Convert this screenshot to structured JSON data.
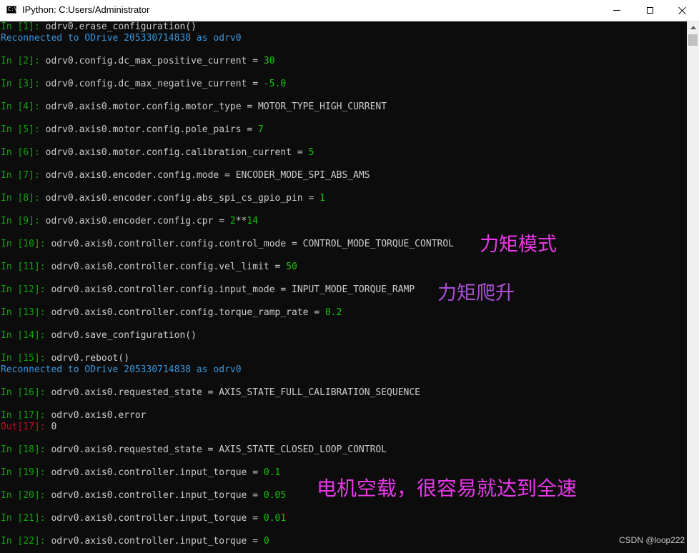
{
  "window": {
    "title": "IPython: C:Users/Administrator",
    "icon_label": "C:\\",
    "buttons": {
      "minimize": "minimize-icon",
      "maximize": "maximize-icon",
      "close": "close-icon"
    }
  },
  "colors": {
    "background": "#0c0c0c",
    "prompt_in": "#13a10e",
    "prompt_out": "#c50f1f",
    "message": "#3a96dd",
    "number": "#16c60c",
    "annotation_magenta": "#e838e8",
    "annotation_purple": "#a94fd6"
  },
  "console": {
    "lines": [
      {
        "prompt": "In [1]: ",
        "code": "odrv0.erase_configuration()",
        "value": ""
      },
      {
        "message": "Reconnected to ODrive 205330714838 as odrv0"
      },
      {
        "prompt": "In [2]: ",
        "code": "odrv0.config.dc_max_positive_current = ",
        "value": "30"
      },
      {
        "prompt": "In [3]: ",
        "code": "odrv0.config.dc_max_negative_current = ",
        "value": "-5.0"
      },
      {
        "prompt": "In [4]: ",
        "code": "odrv0.axis0.motor.config.motor_type = MOTOR_TYPE_HIGH_CURRENT",
        "value": ""
      },
      {
        "prompt": "In [5]: ",
        "code": "odrv0.axis0.motor.config.pole_pairs = ",
        "value": "7"
      },
      {
        "prompt": "In [6]: ",
        "code": "odrv0.axis0.motor.config.calibration_current = ",
        "value": "5"
      },
      {
        "prompt": "In [7]: ",
        "code": "odrv0.axis0.encoder.config.mode = ENCODER_MODE_SPI_ABS_AMS",
        "value": ""
      },
      {
        "prompt": "In [8]: ",
        "code": "odrv0.axis0.encoder.config.abs_spi_cs_gpio_pin = ",
        "value": "1"
      },
      {
        "prompt": "In [9]: ",
        "code": "odrv0.axis0.encoder.config.cpr = ",
        "value": "2",
        "op": "**",
        "value2": "14"
      },
      {
        "prompt": "In [10]: ",
        "code": "odrv0.axis0.controller.config.control_mode = CONTROL_MODE_TORQUE_CONTROL",
        "value": ""
      },
      {
        "prompt": "In [11]: ",
        "code": "odrv0.axis0.controller.config.vel_limit = ",
        "value": "50"
      },
      {
        "prompt": "In [12]: ",
        "code": "odrv0.axis0.controller.config.input_mode = INPUT_MODE_TORQUE_RAMP",
        "value": ""
      },
      {
        "prompt": "In [13]: ",
        "code": "odrv0.axis0.controller.config.torque_ramp_rate = ",
        "value": "0.2"
      },
      {
        "prompt": "In [14]: ",
        "code": "odrv0.save_configuration()",
        "value": ""
      },
      {
        "prompt": "In [15]: ",
        "code": "odrv0.reboot()",
        "value": ""
      },
      {
        "message": "Reconnected to ODrive 205330714838 as odrv0"
      },
      {
        "prompt": "In [16]: ",
        "code": "odrv0.axis0.requested_state = AXIS_STATE_FULL_CALIBRATION_SEQUENCE",
        "value": ""
      },
      {
        "prompt": "In [17]: ",
        "code": "odrv0.axis0.error",
        "value": ""
      },
      {
        "out_prompt": "Out[17]: ",
        "code": "0"
      },
      {
        "prompt": "In [18]: ",
        "code": "odrv0.axis0.requested_state = AXIS_STATE_CLOSED_LOOP_CONTROL",
        "value": ""
      },
      {
        "prompt": "In [19]: ",
        "code": "odrv0.axis0.controller.input_torque = ",
        "value": "0.1"
      },
      {
        "prompt": "In [20]: ",
        "code": "odrv0.axis0.controller.input_torque = ",
        "value": "0.05"
      },
      {
        "prompt": "In [21]: ",
        "code": "odrv0.axis0.controller.input_torque = ",
        "value": "0.01"
      },
      {
        "prompt": "In [22]: ",
        "code": "odrv0.axis0.controller.input_torque = ",
        "value": "0"
      }
    ]
  },
  "annotations": {
    "torque_mode": "力矩模式",
    "torque_ramp": "力矩爬升",
    "no_load": "电机空载，很容易就达到全速"
  },
  "watermark": "CSDN @loop222"
}
